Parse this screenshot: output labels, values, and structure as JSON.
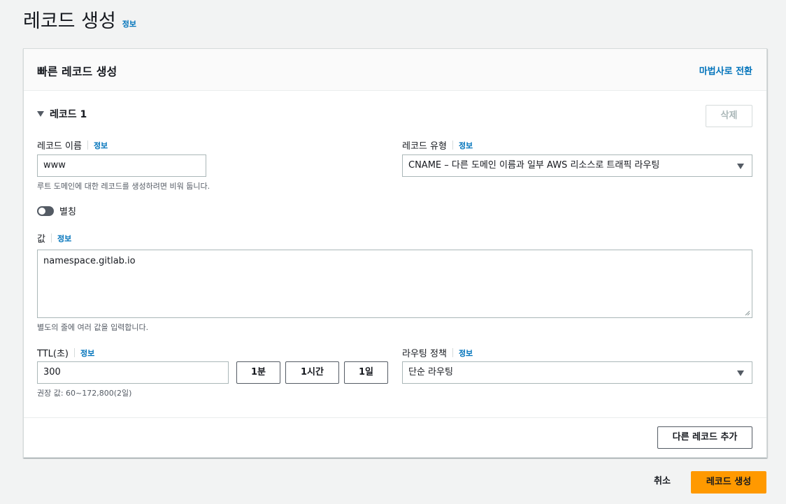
{
  "page": {
    "title": "레코드 생성",
    "info": "정보"
  },
  "panel": {
    "title": "빠른 레코드 생성",
    "wizard_link": "마법사로 전환",
    "record_heading": "레코드 1",
    "delete_button": "삭제",
    "record_name": {
      "label": "레코드 이름",
      "info": "정보",
      "value": "www",
      "hint": "루트 도메인에 대한 레코드를 생성하려면 비워 둡니다."
    },
    "record_type": {
      "label": "레코드 유형",
      "info": "정보",
      "selected": "CNAME – 다른 도메인 이름과 일부 AWS 리소스로 트래픽 라우팅"
    },
    "alias": {
      "label": "별칭",
      "enabled": false
    },
    "value": {
      "label": "값",
      "info": "정보",
      "text": "namespace.gitlab.io",
      "hint": "별도의 줄에 여러 값을 입력합니다."
    },
    "ttl": {
      "label": "TTL(초)",
      "info": "정보",
      "value": "300",
      "hint": "권장 값: 60~172,800(2일)",
      "presets": [
        "1분",
        "1시간",
        "1일"
      ]
    },
    "routing_policy": {
      "label": "라우팅 정책",
      "info": "정보",
      "selected": "단순 라우팅"
    },
    "add_record_button": "다른 레코드 추가"
  },
  "footer": {
    "cancel": "취소",
    "create": "레코드 생성"
  },
  "colors": {
    "background": "#f2f3f3",
    "link": "#0073bb",
    "primary": "#ff9900",
    "border": "#aab7b8"
  }
}
